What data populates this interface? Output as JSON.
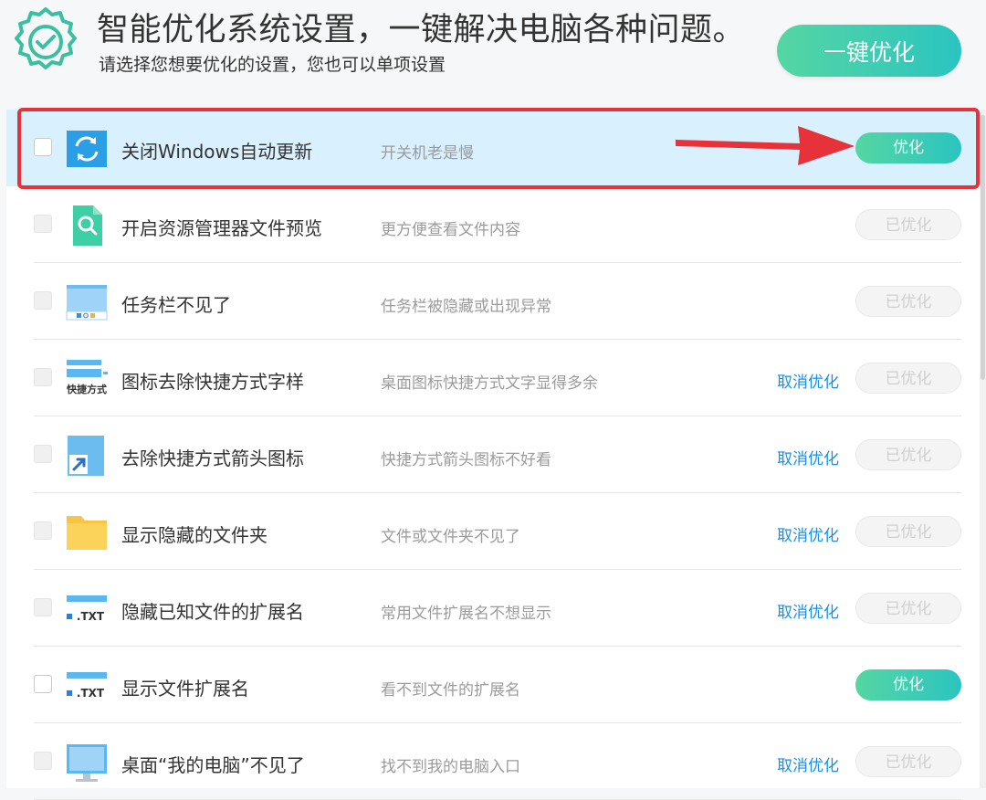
{
  "header": {
    "title": "智能优化系统设置，一键解决电脑各种问题。",
    "subtitle": "请选择您想要优化的设置，您也可以单项设置",
    "main_button": "一键优化"
  },
  "colors": {
    "accent_green": "#3ccfae",
    "link_blue": "#1a8fe3",
    "highlight_red": "#e8323a",
    "highlight_bg": "#d9f0ff"
  },
  "items": [
    {
      "label": "关闭Windows自动更新",
      "desc": "开关机老是慢",
      "cancel": "",
      "button": "优化",
      "icon": "windows-update-icon"
    },
    {
      "label": "开启资源管理器文件预览",
      "desc": "更方便查看文件内容",
      "cancel": "",
      "button": "已优化",
      "icon": "file-preview-icon"
    },
    {
      "label": "任务栏不见了",
      "desc": "任务栏被隐藏或出现异常",
      "cancel": "",
      "button": "已优化",
      "icon": "taskbar-icon"
    },
    {
      "label": "图标去除快捷方式字样",
      "desc": "桌面图标快捷方式文字显得多余",
      "cancel": "取消优化",
      "button": "已优化",
      "icon": "shortcut-text-icon",
      "icon_text": "快捷方式"
    },
    {
      "label": "去除快捷方式箭头图标",
      "desc": "快捷方式箭头图标不好看",
      "cancel": "取消优化",
      "button": "已优化",
      "icon": "shortcut-arrow-icon"
    },
    {
      "label": "显示隐藏的文件夹",
      "desc": "文件或文件夹不见了",
      "cancel": "取消优化",
      "button": "已优化",
      "icon": "folder-icon"
    },
    {
      "label": "隐藏已知文件的扩展名",
      "desc": "常用文件扩展名不想显示",
      "cancel": "取消优化",
      "button": "已优化",
      "icon": "txt-extension-icon",
      "icon_text": ".TXT"
    },
    {
      "label": "显示文件扩展名",
      "desc": "看不到文件的扩展名",
      "cancel": "",
      "button": "优化",
      "icon": "txt-extension-icon",
      "icon_text": ".TXT"
    },
    {
      "label": "桌面“我的电脑”不见了",
      "desc": "找不到我的电脑入口",
      "cancel": "取消优化",
      "button": "已优化",
      "icon": "computer-icon"
    }
  ]
}
